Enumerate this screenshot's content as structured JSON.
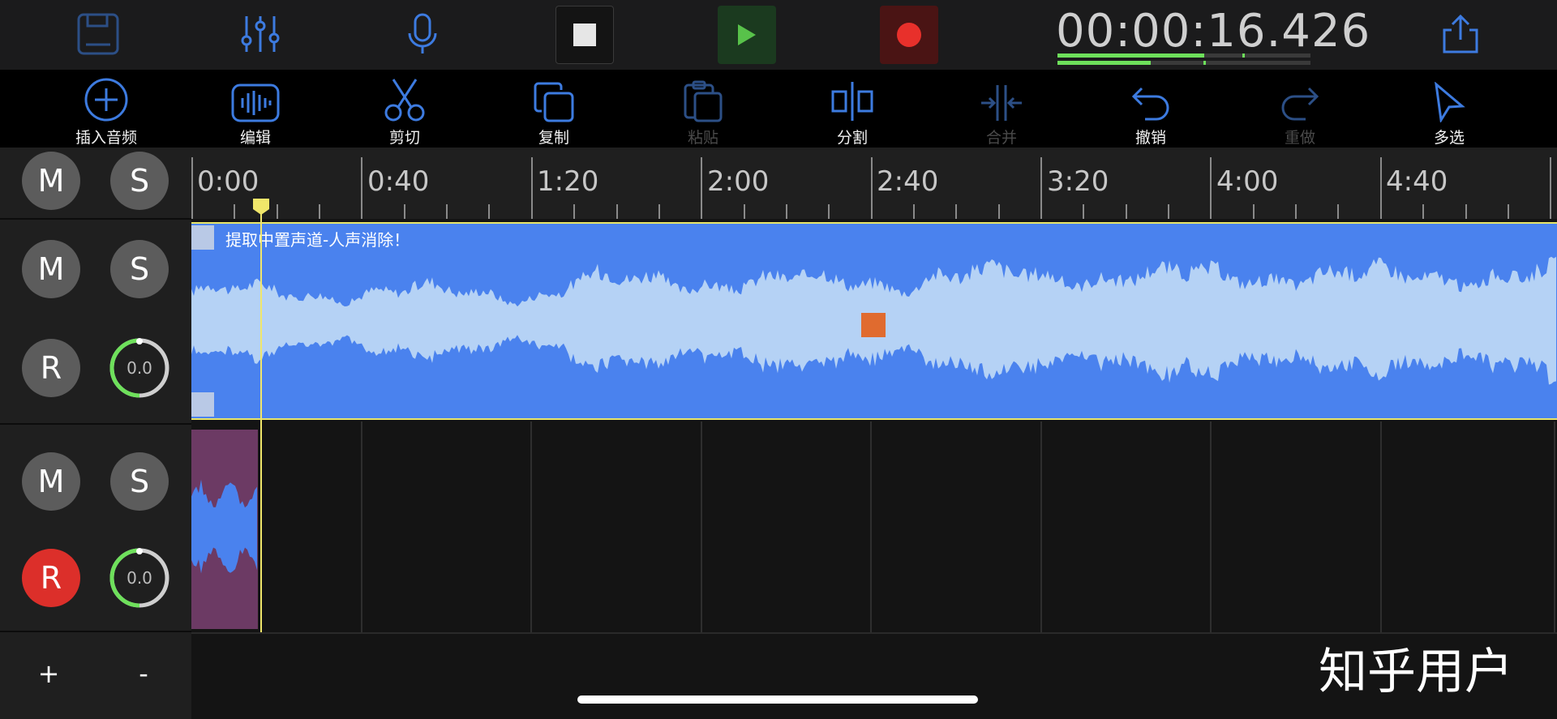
{
  "topbar": {
    "timecode": "00:00:16.426",
    "meter_levels": [
      0.58,
      0.37
    ]
  },
  "toolbar": {
    "items": [
      {
        "label": "插入音频",
        "icon": "insert-audio-icon",
        "enabled": true
      },
      {
        "label": "编辑",
        "icon": "edit-waveform-icon",
        "enabled": true
      },
      {
        "label": "剪切",
        "icon": "scissors-icon",
        "enabled": true
      },
      {
        "label": "复制",
        "icon": "copy-icon",
        "enabled": true
      },
      {
        "label": "粘贴",
        "icon": "paste-icon",
        "enabled": false
      },
      {
        "label": "分割",
        "icon": "split-icon",
        "enabled": true
      },
      {
        "label": "合并",
        "icon": "merge-icon",
        "enabled": false
      },
      {
        "label": "撤销",
        "icon": "undo-icon",
        "enabled": true
      },
      {
        "label": "重做",
        "icon": "redo-icon",
        "enabled": false
      },
      {
        "label": "多选",
        "icon": "multi-select-icon",
        "enabled": true
      }
    ]
  },
  "master": {
    "mute": "M",
    "solo": "S"
  },
  "tracks": [
    {
      "mute": "M",
      "solo": "S",
      "record": "R",
      "record_armed": false,
      "volume": "0.0",
      "clip_title": "提取中置声道-人声消除！"
    },
    {
      "mute": "M",
      "solo": "S",
      "record": "R",
      "record_armed": true,
      "volume": "0.0"
    }
  ],
  "ruler": {
    "labels": [
      "0:00",
      "0:40",
      "1:20",
      "2:00",
      "2:40",
      "3:20",
      "4:00",
      "4:40"
    ]
  },
  "footer": {
    "add": "+",
    "remove": "-"
  },
  "watermark": "知乎用户",
  "colors": {
    "clip_blue": "#4a82ee",
    "waveform_light": "#b5d2f5",
    "clip_purple": "#6c3a64",
    "accent_blue": "#3d7be0",
    "record_red": "#dc2f2a",
    "play_green": "#58c24a",
    "playhead_yellow": "#f0e66a"
  }
}
